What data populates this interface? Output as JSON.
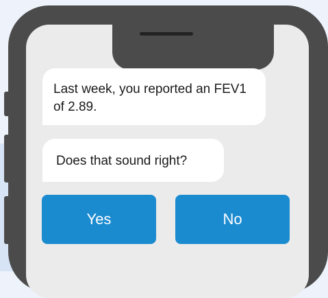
{
  "chat": {
    "message_1": "Last week, you reported an FEV1 of 2.89.",
    "message_2": "Does that sound right?"
  },
  "actions": {
    "yes_label": "Yes",
    "no_label": "No"
  },
  "colors": {
    "frame": "#4b4b4b",
    "screen": "#ebebeb",
    "bubble": "#ffffff",
    "button": "#1b8bd0",
    "background": "#eef3fb"
  }
}
